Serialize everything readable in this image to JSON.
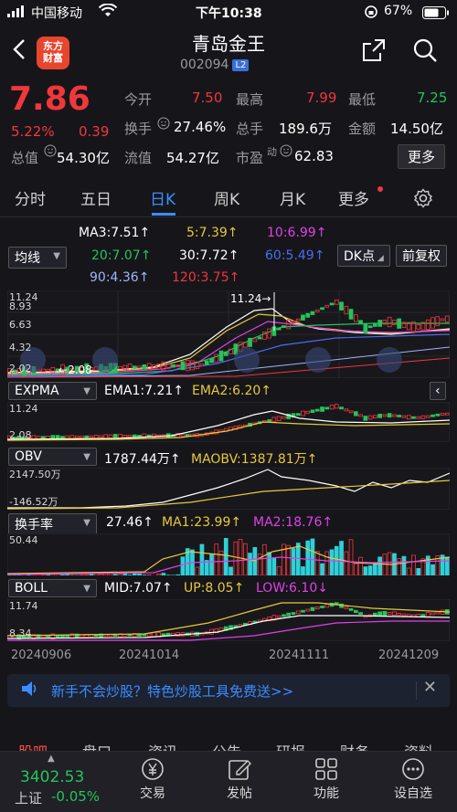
{
  "status_bar": {
    "carrier": "中国移动",
    "time": "下午10:38",
    "battery": "67%"
  },
  "header": {
    "logo": "东方\n财富",
    "title": "青岛金王",
    "code": "002094",
    "badge": "L2"
  },
  "quote": {
    "price": "7.86",
    "change_pct": "5.22%",
    "change": "0.39",
    "open_label": "今开",
    "open": "7.50",
    "high_label": "最高",
    "high": "7.99",
    "low_label": "最低",
    "low": "7.25",
    "turnover_label": "换手",
    "turnover": "27.46%",
    "volume_label": "总手",
    "volume": "189.6万",
    "amount_label": "金额",
    "amount": "14.50亿",
    "mktcap_label": "总值",
    "mktcap": "54.30亿",
    "float_label": "流值",
    "float": "54.27亿",
    "pe_label": "市盈",
    "pe_sup": "动",
    "pe": "62.83",
    "more": "更多"
  },
  "tabs": [
    "分时",
    "五日",
    "日K",
    "周K",
    "月K",
    "更多"
  ],
  "active_tab": "日K",
  "ma": {
    "ma3": "MA3:7.51↑",
    "ma5": "5:7.39↑",
    "ma10": "10:6.99↑",
    "ma20": "20:7.07↑",
    "ma30": "30:7.72↑",
    "ma60": "60:5.49↑",
    "ma90": "90:4.36↑",
    "ma120": "120:3.75↑",
    "select": "均线",
    "dk": "DK点",
    "fq": "前复权"
  },
  "kline": {
    "y_labels": [
      "11.24",
      "8.93",
      "6.63",
      "4.32",
      "2.02"
    ],
    "max_marker": "11.24",
    "min_marker": "2.08"
  },
  "expma": {
    "select": "EXPMA",
    "ema1": "EMA1:7.21↑",
    "ema2": "EMA2:6.20↑",
    "y_labels": [
      "11.24",
      "2.08"
    ]
  },
  "obv": {
    "select": "OBV",
    "obv": "1787.44万↑",
    "maobv": "MAOBV:1387.81万↑",
    "y_labels": [
      "2147.50万",
      "-146.52万"
    ]
  },
  "hsl": {
    "select": "换手率",
    "val": "27.46↑",
    "ma1": "MA1:23.99↑",
    "ma2": "MA2:18.76↑",
    "y_labels": [
      "50.44"
    ]
  },
  "boll": {
    "select": "BOLL",
    "mid": "MID:7.07↑",
    "up": "UP:8.05↑",
    "low": "LOW:6.10↓",
    "y_labels": [
      "11.74",
      "8.34"
    ]
  },
  "dates": [
    "20240906",
    "20241014",
    "20241111",
    "20241209"
  ],
  "banner": {
    "text": "新手不会炒股？特色炒股工具免费送>>"
  },
  "subtabs": [
    "股吧",
    "盘口",
    "资讯",
    "公告",
    "研报",
    "财务",
    "资料"
  ],
  "bottom_nav": {
    "index_value": "3402.53",
    "index_name": "上证",
    "index_change": "-0.05%",
    "items": [
      "交易",
      "发帖",
      "功能",
      "设自选"
    ]
  },
  "colors": {
    "up": "#f0373c",
    "down": "#25c35c",
    "accent": "#3c8cff",
    "bg": "#16161a"
  }
}
